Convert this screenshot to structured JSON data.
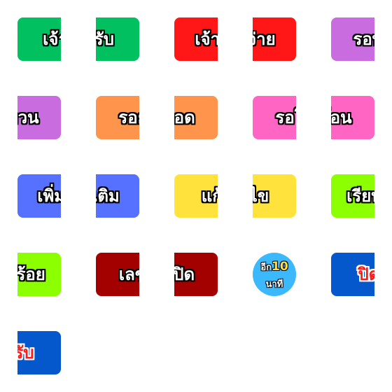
{
  "stickers": [
    {
      "word": "เจ้ารับ",
      "half": "left",
      "bg": "#00c060",
      "text_color": "#ffffff"
    },
    {
      "word": "เจ้ารับ",
      "half": "right",
      "bg": "#00c060",
      "text_color": "#ffffff"
    },
    {
      "word": "เจ้าจ่าย",
      "half": "left",
      "bg": "#ff1616",
      "text_color": "#ffffff"
    },
    {
      "word": "เจ้าจ่าย",
      "half": "right",
      "bg": "#ff1616",
      "text_color": "#ffffff"
    },
    {
      "word": "รอทวน",
      "half": "left",
      "bg": "#c86ce0",
      "text_color": "#ffffff"
    },
    {
      "word": "รอทวน",
      "half": "right",
      "bg": "#c86ce0",
      "text_color": "#ffffff"
    },
    {
      "word": "รอยอด",
      "half": "left",
      "bg": "#ff944c",
      "text_color": "#ffffff"
    },
    {
      "word": "รอยอด",
      "half": "right",
      "bg": "#ff944c",
      "text_color": "#ffffff"
    },
    {
      "word": "รอโอน",
      "half": "left",
      "bg": "#ff66c4",
      "text_color": "#ffffff"
    },
    {
      "word": "รอโอน",
      "half": "right",
      "bg": "#ff66c4",
      "text_color": "#ffffff"
    },
    {
      "word": "เพิ่มเติม",
      "half": "left",
      "bg": "#5670ff",
      "text_color": "#ffffff"
    },
    {
      "word": "เพิ่มเติม",
      "half": "right",
      "bg": "#5670ff",
      "text_color": "#ffffff"
    },
    {
      "word": "แก้ไข",
      "half": "left",
      "bg": "#ffe23c",
      "text_color": "#ffffff"
    },
    {
      "word": "แก้ไข",
      "half": "right",
      "bg": "#ffe23c",
      "text_color": "#ffffff"
    },
    {
      "word": "เรียบร้อย",
      "half": "left",
      "bg": "#8cff00",
      "text_color": "#ffffff"
    },
    {
      "word": "เรียบร้อย",
      "half": "right",
      "bg": "#8cff00",
      "text_color": "#ffffff"
    },
    {
      "word": "เลขปิด",
      "half": "left",
      "bg": "#a30000",
      "text_color": "#ffffff"
    },
    {
      "word": "เลขปิด",
      "half": "right",
      "bg": "#a30000",
      "text_color": "#ffffff"
    },
    {
      "word": "",
      "half": "circle",
      "bg": "#3cb8ff",
      "text_color": "#ffffff"
    },
    {
      "word": "ปิดรับ",
      "half": "left",
      "bg": "#0558cc",
      "text_color": "#ff1a1a"
    },
    {
      "word": "ปิดรับ",
      "half": "right",
      "bg": "#0558cc",
      "text_color": "#ff1a1a"
    }
  ],
  "timer_sticker": {
    "prefix": "อีก",
    "number": "10",
    "suffix": "นาที",
    "number_color": "#ffe23c"
  }
}
